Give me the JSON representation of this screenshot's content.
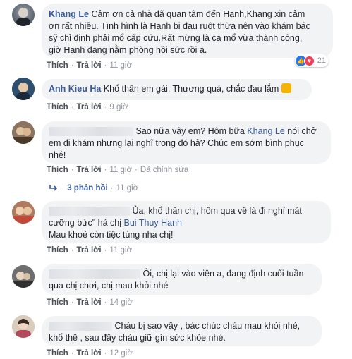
{
  "comments": [
    {
      "author": "Khang Le",
      "text": "Cảm ơn cả nhà đã quan tâm đến Hạnh,Khang xin cảm ơn rất nhiều. Tình hình là Hạnh bị đau ruột thừa nên vào khám bác sỹ chỉ định phải mổ cấp cứu.Rất mừng là ca mổ vừa thành công, giờ Hạnh đang nằm phòng hồi sức rồi ạ.",
      "line1": "Cảm ơn cả nhà đã quan tâm đến Hạnh,Khang xin cảm",
      "line2": "ơn rất nhiều. Tình hình là Hạnh bị đau ruột thừa nên vào khám bác",
      "line3": "sỹ chỉ định phải mổ cấp cứu.Rất mừng là ca mổ vừa thành công,",
      "line4": "giờ Hạnh đang nằm phòng hồi sức rồi ạ.",
      "like": "Thích",
      "reply": "Trả lời",
      "time": "11 giờ",
      "reaction_count": "21"
    },
    {
      "author": "Anh Kieu Ha",
      "text": "Khổ thân em gái. Thương quá, chắc đau lắm",
      "like": "Thích",
      "reply": "Trả lời",
      "time": "9 giờ"
    },
    {
      "line1": "Sao nữa vậy em? Hôm bữa",
      "mention": "Khang Le",
      "line1_end": "nói chở",
      "line2": "em đi khám nhưng lại nghĩ trong đó hả? Chúc em sớm bình phục",
      "line3": "nhé!",
      "like": "Thích",
      "reply": "Trả lời",
      "time": "11 giờ",
      "edited": "Đã chỉnh sửa",
      "replies": "3 phản hồi",
      "replies_time": "11 giờ"
    },
    {
      "line1": "Ủa, khổ thân chị, hôm qua về là đi nghỉ mát",
      "line2": "cưỡng bức\" hả chị",
      "mention": "Bui Thuy Hanh",
      "line3": "Mau khoẻ còn tiệc tùng nha chị!",
      "like": "Thích",
      "reply": "Trả lời",
      "time": "11 giờ"
    },
    {
      "line1": "Ôi, chị lại vào viện a, đang định cuối tuần",
      "line2": "qua chị chơi, chị mau khỏi nhé",
      "like": "Thích",
      "reply": "Trả lời",
      "time": "14 giờ"
    },
    {
      "line1": "Cháu bị sao vậy , bác chúc cháu mau khỏi nhé,",
      "line2": "khổ thế , sau đây cháu giữ gìn sức khỏe nhé.",
      "like": "Thích",
      "reply": "Trả lời",
      "time": "12 giờ"
    }
  ],
  "separator": "·",
  "colors": {
    "link": "#385898",
    "bubble": "#f2f3f5",
    "meta": "#90949c"
  }
}
